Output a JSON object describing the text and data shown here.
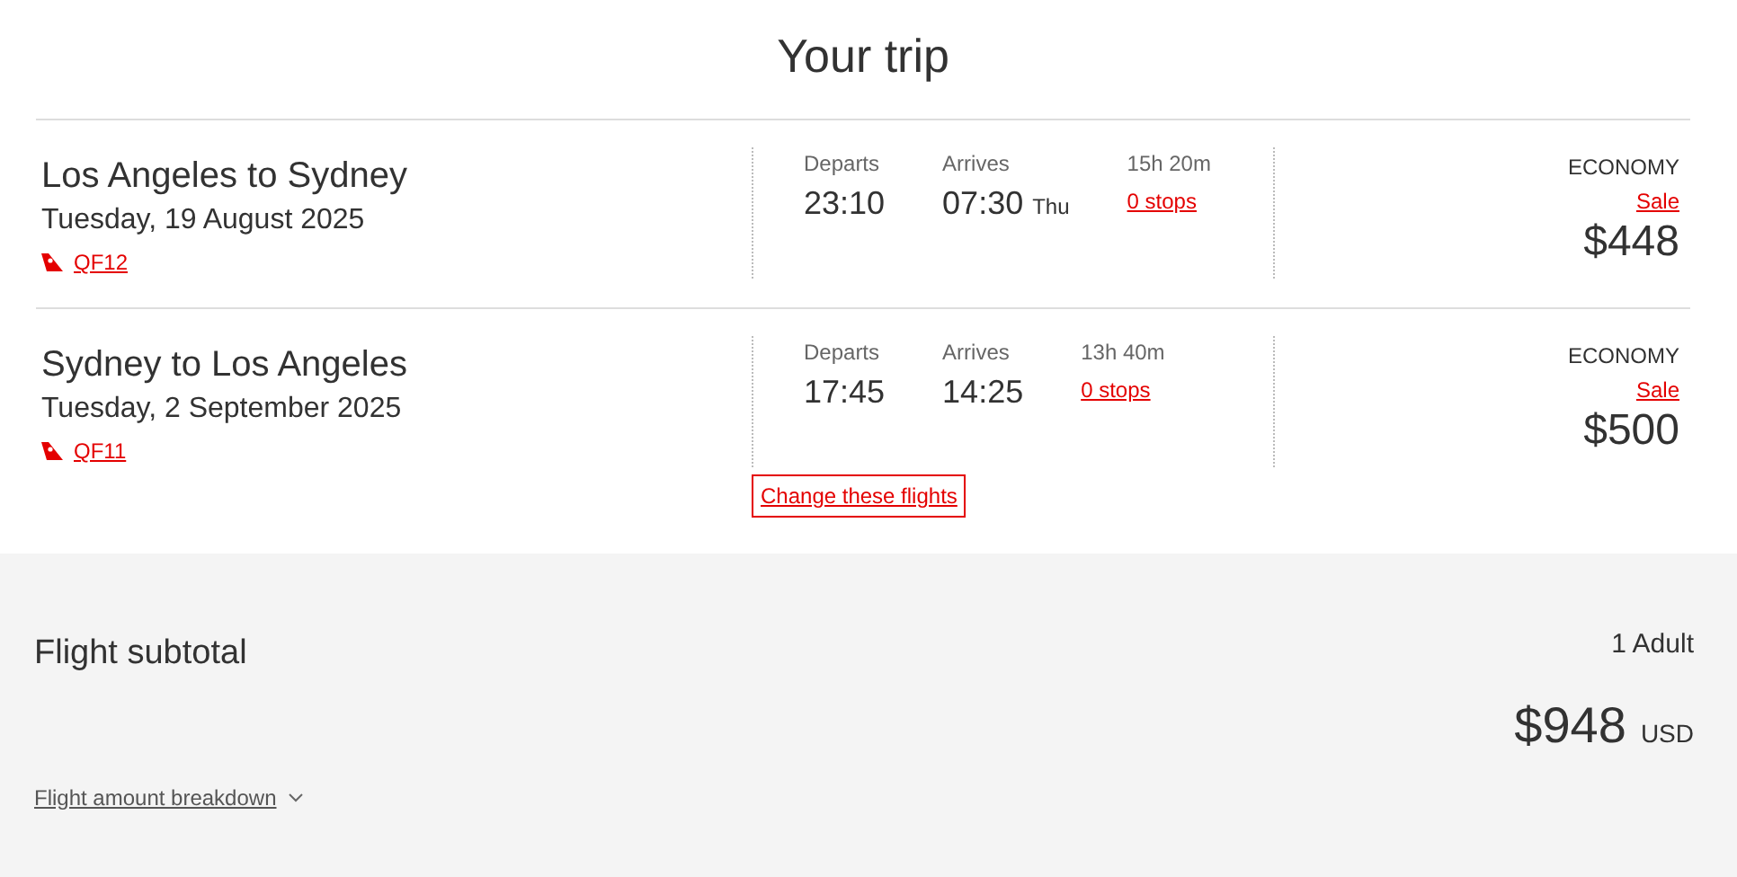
{
  "title": "Your trip",
  "flights": [
    {
      "route": "Los Angeles to Sydney",
      "date": "Tuesday, 19 August 2025",
      "flight_number": "QF12",
      "departs_label": "Departs",
      "departs": "23:10",
      "arrives_label": "Arrives",
      "arrives": "07:30",
      "arrives_day": "Thu",
      "duration": "15h 20m",
      "stops": "0 stops",
      "cabin": "ECONOMY",
      "fare": "Sale",
      "price": "$448"
    },
    {
      "route": "Sydney to Los Angeles",
      "date": "Tuesday, 2 September 2025",
      "flight_number": "QF11",
      "departs_label": "Departs",
      "departs": "17:45",
      "arrives_label": "Arrives",
      "arrives": "14:25",
      "duration": "13h 40m",
      "stops": "0 stops",
      "cabin": "ECONOMY",
      "fare": "Sale",
      "price": "$500"
    }
  ],
  "change_link": "Change these flights",
  "subtotal": {
    "label": "Flight subtotal",
    "passengers": "1 Adult",
    "amount": "$948",
    "currency": "USD",
    "breakdown": "Flight amount breakdown"
  }
}
